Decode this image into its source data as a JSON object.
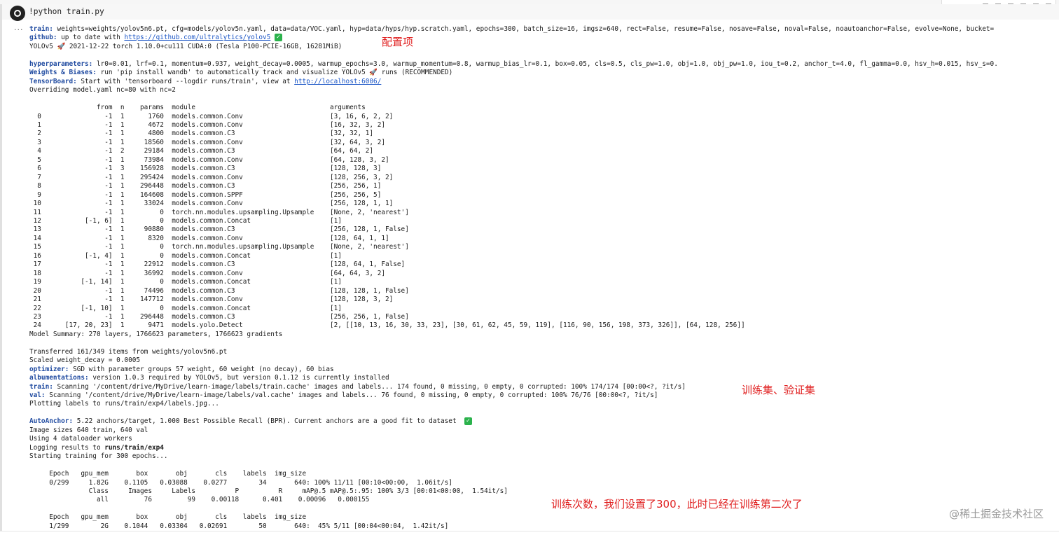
{
  "cell": {
    "command": "!python train.py",
    "output_menu": "...",
    "lines": [
      {
        "label": "train:",
        "text": " weights=weights/yolov5n6.pt, cfg=models/yolov5n.yaml, data=data/VOC.yaml, hyp=data/hyps/hyp.scratch.yaml, epochs=300, batch_size=16, imgsz=640, rect=False, resume=False, nosave=False, noval=False, noautoanchor=False, evolve=None, bucket="
      },
      {
        "label": "github:",
        "text": " up to date with ",
        "link": "https://github.com/ultralytics/yolov5",
        "check": true
      },
      {
        "text": "YOLOv5 🚀 2021-12-22 torch 1.10.0+cu111 CUDA:0 (Tesla P100-PCIE-16GB, 16281MiB)"
      },
      {
        "text": ""
      },
      {
        "label": "hyperparameters:",
        "text": " lr0=0.01, lrf=0.1, momentum=0.937, weight_decay=0.0005, warmup_epochs=3.0, warmup_momentum=0.8, warmup_bias_lr=0.1, box=0.05, cls=0.5, cls_pw=1.0, obj=1.0, obj_pw=1.0, iou_t=0.2, anchor_t=4.0, fl_gamma=0.0, hsv_h=0.015, hsv_s=0."
      },
      {
        "label": "Weights & Biases:",
        "text": " run 'pip install wandb' to automatically track and visualize YOLOv5 🚀 runs (RECOMMENDED)"
      },
      {
        "label": "TensorBoard:",
        "text": " Start with 'tensorboard --logdir runs/train', view at ",
        "link": "http://localhost:6006/"
      },
      {
        "text": "Overriding model.yaml nc=80 with nc=2"
      },
      {
        "text": ""
      },
      {
        "text": "                 from  n    params  module                                  arguments                     "
      },
      {
        "text": "  0                -1  1      1760  models.common.Conv                      [3, 16, 6, 2, 2]              "
      },
      {
        "text": "  1                -1  1      4672  models.common.Conv                      [16, 32, 3, 2]                "
      },
      {
        "text": "  2                -1  1      4800  models.common.C3                        [32, 32, 1]                   "
      },
      {
        "text": "  3                -1  1     18560  models.common.Conv                      [32, 64, 3, 2]                "
      },
      {
        "text": "  4                -1  2     29184  models.common.C3                        [64, 64, 2]                   "
      },
      {
        "text": "  5                -1  1     73984  models.common.Conv                      [64, 128, 3, 2]               "
      },
      {
        "text": "  6                -1  3    156928  models.common.C3                        [128, 128, 3]                 "
      },
      {
        "text": "  7                -1  1    295424  models.common.Conv                      [128, 256, 3, 2]              "
      },
      {
        "text": "  8                -1  1    296448  models.common.C3                        [256, 256, 1]                 "
      },
      {
        "text": "  9                -1  1    164608  models.common.SPPF                      [256, 256, 5]                 "
      },
      {
        "text": " 10                -1  1     33024  models.common.Conv                      [256, 128, 1, 1]              "
      },
      {
        "text": " 11                -1  1         0  torch.nn.modules.upsampling.Upsample    [None, 2, 'nearest']          "
      },
      {
        "text": " 12           [-1, 6]  1         0  models.common.Concat                    [1]                           "
      },
      {
        "text": " 13                -1  1     90880  models.common.C3                        [256, 128, 1, False]          "
      },
      {
        "text": " 14                -1  1      8320  models.common.Conv                      [128, 64, 1, 1]               "
      },
      {
        "text": " 15                -1  1         0  torch.nn.modules.upsampling.Upsample    [None, 2, 'nearest']          "
      },
      {
        "text": " 16           [-1, 4]  1         0  models.common.Concat                    [1]                           "
      },
      {
        "text": " 17                -1  1     22912  models.common.C3                        [128, 64, 1, False]           "
      },
      {
        "text": " 18                -1  1     36992  models.common.Conv                      [64, 64, 3, 2]                "
      },
      {
        "text": " 19          [-1, 14]  1         0  models.common.Concat                    [1]                           "
      },
      {
        "text": " 20                -1  1     74496  models.common.C3                        [128, 128, 1, False]          "
      },
      {
        "text": " 21                -1  1    147712  models.common.Conv                      [128, 128, 3, 2]              "
      },
      {
        "text": " 22          [-1, 10]  1         0  models.common.Concat                    [1]                           "
      },
      {
        "text": " 23                -1  1    296448  models.common.C3                        [256, 256, 1, False]          "
      },
      {
        "text": " 24      [17, 20, 23]  1      9471  models.yolo.Detect                      [2, [[10, 13, 16, 30, 33, 23], [30, 61, 62, 45, 59, 119], [116, 90, 156, 198, 373, 326]], [64, 128, 256]]"
      },
      {
        "text": "Model Summary: 270 layers, 1766623 parameters, 1766623 gradients"
      },
      {
        "text": ""
      },
      {
        "text": "Transferred 161/349 items from weights/yolov5n6.pt"
      },
      {
        "text": "Scaled weight_decay = 0.0005"
      },
      {
        "label": "optimizer:",
        "text": " SGD with parameter groups 57 weight, 60 weight (no decay), 60 bias"
      },
      {
        "label": "albumentations:",
        "text": " version 1.0.3 required by YOLOv5, but version 0.1.12 is currently installed"
      },
      {
        "label": "train:",
        "text": " Scanning '/content/drive/MyDrive/learn-image/labels/train.cache' images and labels... 174 found, 0 missing, 0 empty, 0 corrupted: 100% 174/174 [00:00<?, ?it/s]"
      },
      {
        "label": "val:",
        "text": " Scanning '/content/drive/MyDrive/learn-image/labels/val.cache' images and labels... 76 found, 0 missing, 0 empty, 0 corrupted: 100% 76/76 [00:00<?, ?it/s]"
      },
      {
        "text": "Plotting labels to runs/train/exp4/labels.jpg... "
      },
      {
        "text": ""
      },
      {
        "label": "AutoAnchor:",
        "text": " 5.22 anchors/target, 1.000 Best Possible Recall (BPR). Current anchors are a good fit to dataset ",
        "check": true
      },
      {
        "text": "Image sizes 640 train, 640 val"
      },
      {
        "text": "Using 4 dataloader workers"
      },
      {
        "text": "Logging results to ",
        "bold_tail": "runs/train/exp4"
      },
      {
        "text": "Starting training for 300 epochs..."
      },
      {
        "text": ""
      },
      {
        "text": "     Epoch   gpu_mem       box       obj       cls    labels  img_size"
      },
      {
        "text": "     0/299     1.82G    0.1105   0.03088    0.0277        34       640: 100% 11/11 [00:10<00:00,  1.06it/s]"
      },
      {
        "text": "               Class     Images     Labels          P          R     mAP@.5 mAP@.5:.95: 100% 3/3 [00:01<00:00,  1.54it/s]"
      },
      {
        "text": "                 all         76         99    0.00118      0.401    0.00096   0.000155"
      },
      {
        "text": ""
      },
      {
        "text": "     Epoch   gpu_mem       box       obj       cls    labels  img_size"
      },
      {
        "text": "     1/299        2G    0.1044   0.03304   0.02691        50       640:  45% 5/11 [00:04<00:04,  1.42it/s]"
      }
    ]
  },
  "annotations": {
    "config": "配置项",
    "datasets": "训练集、验证集",
    "epochs": "训练次数，我们设置了300，此时已经在训练第二次了"
  },
  "watermark": "@稀土掘金技术社区",
  "icons": {
    "run": "run-button-icon",
    "check": "check-mark-icon"
  }
}
